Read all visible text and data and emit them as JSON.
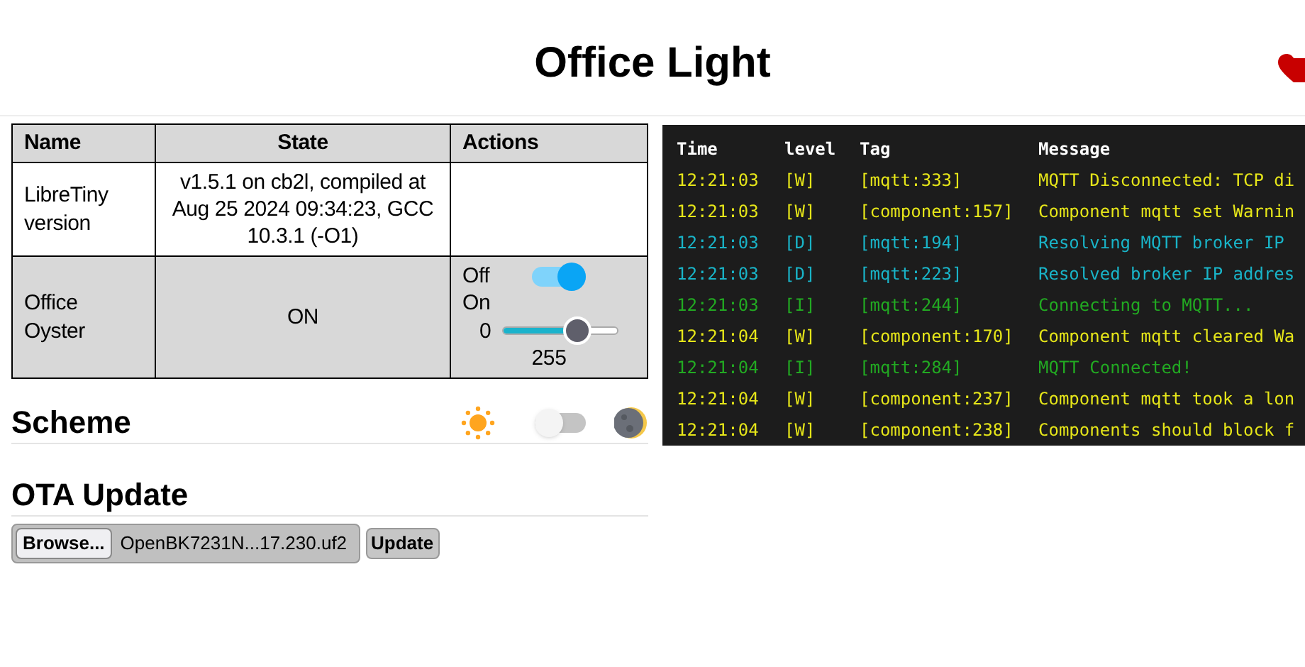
{
  "title": "Office Light",
  "table": {
    "columns": [
      "Name",
      "State",
      "Actions"
    ],
    "rows": [
      {
        "name": "LibreTiny version",
        "state": "v1.5.1 on cb2l, compiled at Aug 25 2024 09:34:23, GCC 10.3.1 (-O1)"
      },
      {
        "name": "Office Oyster",
        "state": "ON",
        "actions": {
          "off_label": "Off",
          "on_label": "On",
          "on": true,
          "min_label": "0",
          "level": 0.65,
          "max_label": "255"
        }
      }
    ]
  },
  "scheme": {
    "title": "Scheme",
    "dark": false
  },
  "ota": {
    "title": "OTA Update",
    "browse": "Browse...",
    "file": "OpenBK7231N...17.230.uf2",
    "update": "Update"
  },
  "log": {
    "columns": [
      "Time",
      "level",
      "Tag",
      "Message"
    ],
    "rows": [
      {
        "time": "12:21:03",
        "level": "[W]",
        "tag": "[mqtt:333]",
        "message": "MQTT Disconnected: TCP di",
        "color": "#e6e619"
      },
      {
        "time": "12:21:03",
        "level": "[W]",
        "tag": "[component:157]",
        "message": "Component mqtt set Warnin",
        "color": "#e6e619"
      },
      {
        "time": "12:21:03",
        "level": "[D]",
        "tag": "[mqtt:194]",
        "message": "Resolving MQTT broker IP",
        "color": "#19b4c8"
      },
      {
        "time": "12:21:03",
        "level": "[D]",
        "tag": "[mqtt:223]",
        "message": "Resolved broker IP addres",
        "color": "#19b4c8"
      },
      {
        "time": "12:21:03",
        "level": "[I]",
        "tag": "[mqtt:244]",
        "message": "Connecting to MQTT...",
        "color": "#22aa22"
      },
      {
        "time": "12:21:04",
        "level": "[W]",
        "tag": "[component:170]",
        "message": "Component mqtt cleared Wa",
        "color": "#e6e619"
      },
      {
        "time": "12:21:04",
        "level": "[I]",
        "tag": "[mqtt:284]",
        "message": "MQTT Connected!",
        "color": "#22aa22"
      },
      {
        "time": "12:21:04",
        "level": "[W]",
        "tag": "[component:237]",
        "message": "Component mqtt took a lon",
        "color": "#e6e619"
      },
      {
        "time": "12:21:04",
        "level": "[W]",
        "tag": "[component:238]",
        "message": "Components should block f",
        "color": "#e6e619"
      }
    ]
  }
}
